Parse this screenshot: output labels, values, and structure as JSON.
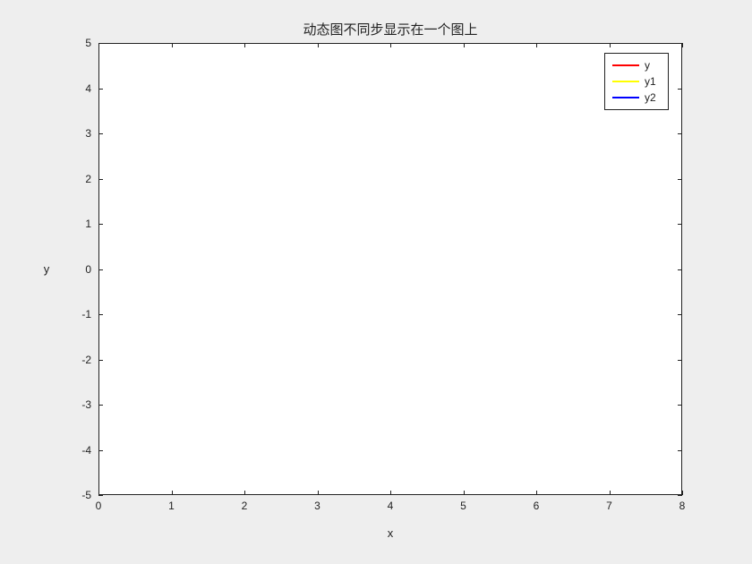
{
  "chart_data": {
    "type": "line",
    "title": "动态图不同步显示在一个图上",
    "xlabel": "x",
    "ylabel": "y",
    "xlim": [
      0,
      8
    ],
    "ylim": [
      -5,
      5
    ],
    "xticks": [
      0,
      1,
      2,
      3,
      4,
      5,
      6,
      7,
      8
    ],
    "yticks": [
      -5,
      -4,
      -3,
      -2,
      -1,
      0,
      1,
      2,
      3,
      4,
      5
    ],
    "series": [
      {
        "name": "y",
        "color": "#ff0000",
        "x": [],
        "values": []
      },
      {
        "name": "y1",
        "color": "#ffff00",
        "x": [],
        "values": []
      },
      {
        "name": "y2",
        "color": "#0000ff",
        "x": [],
        "values": []
      }
    ],
    "legend_position": "northeast",
    "grid": false
  }
}
